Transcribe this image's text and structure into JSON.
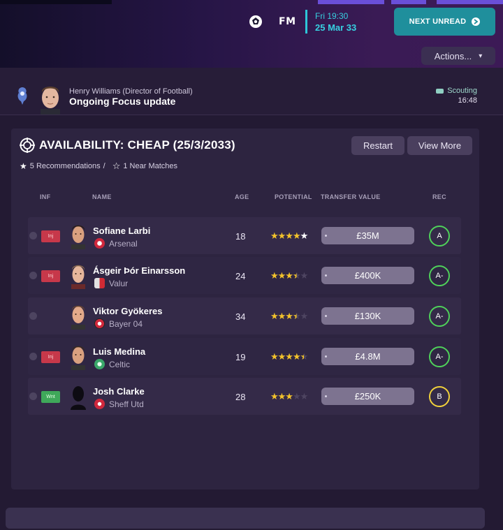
{
  "topbar": {
    "brand": "FM",
    "date_line1": "Fri 19:30",
    "date_line2": "25 Mar 33",
    "next_unread_label": "NEXT UNREAD",
    "actions_label": "Actions..."
  },
  "message": {
    "sender": "Henry Williams (Director of Football)",
    "subject": "Ongoing Focus update",
    "category": "Scouting",
    "time": "16:48"
  },
  "panel": {
    "title": "AVAILABILITY: CHEAP (25/3/2033)",
    "restart_label": "Restart",
    "view_more_label": "View More",
    "recommendations": "5 Recommendations",
    "separator": "/",
    "near_matches": "1 Near Matches"
  },
  "table": {
    "headers": {
      "inf": "INF",
      "name": "NAME",
      "age": "AGE",
      "potential": "POTENTIAL",
      "transfer_value": "TRANSFER VALUE",
      "rec": "REC"
    },
    "rows": [
      {
        "inf": "Inj",
        "name": "Sofiane Larbi",
        "club": "Arsenal",
        "age": "18",
        "potential_stars": 5,
        "transfer_value": "£35M",
        "rec": "A",
        "rec_color": "#4fd15a"
      },
      {
        "inf": "Inj",
        "name": "Ásgeir Þór Einarsson",
        "club": "Valur",
        "age": "24",
        "potential_stars": 3.5,
        "transfer_value": "£400K",
        "rec": "A-",
        "rec_color": "#4fd15a"
      },
      {
        "inf": "",
        "name": "Viktor Gyökeres",
        "club": "Bayer 04",
        "age": "34",
        "potential_stars": 3.5,
        "transfer_value": "£130K",
        "rec": "A-",
        "rec_color": "#4fd15a"
      },
      {
        "inf": "Inj",
        "name": "Luis Medina",
        "club": "Celtic",
        "age": "19",
        "potential_stars": 4.5,
        "transfer_value": "£4.8M",
        "rec": "A-",
        "rec_color": "#4fd15a"
      },
      {
        "inf": "Wnt",
        "name": "Josh Clarke",
        "club": "Sheff Utd",
        "age": "28",
        "potential_stars": 3,
        "transfer_value": "£250K",
        "rec": "B",
        "rec_color": "#f1d13b"
      }
    ]
  }
}
